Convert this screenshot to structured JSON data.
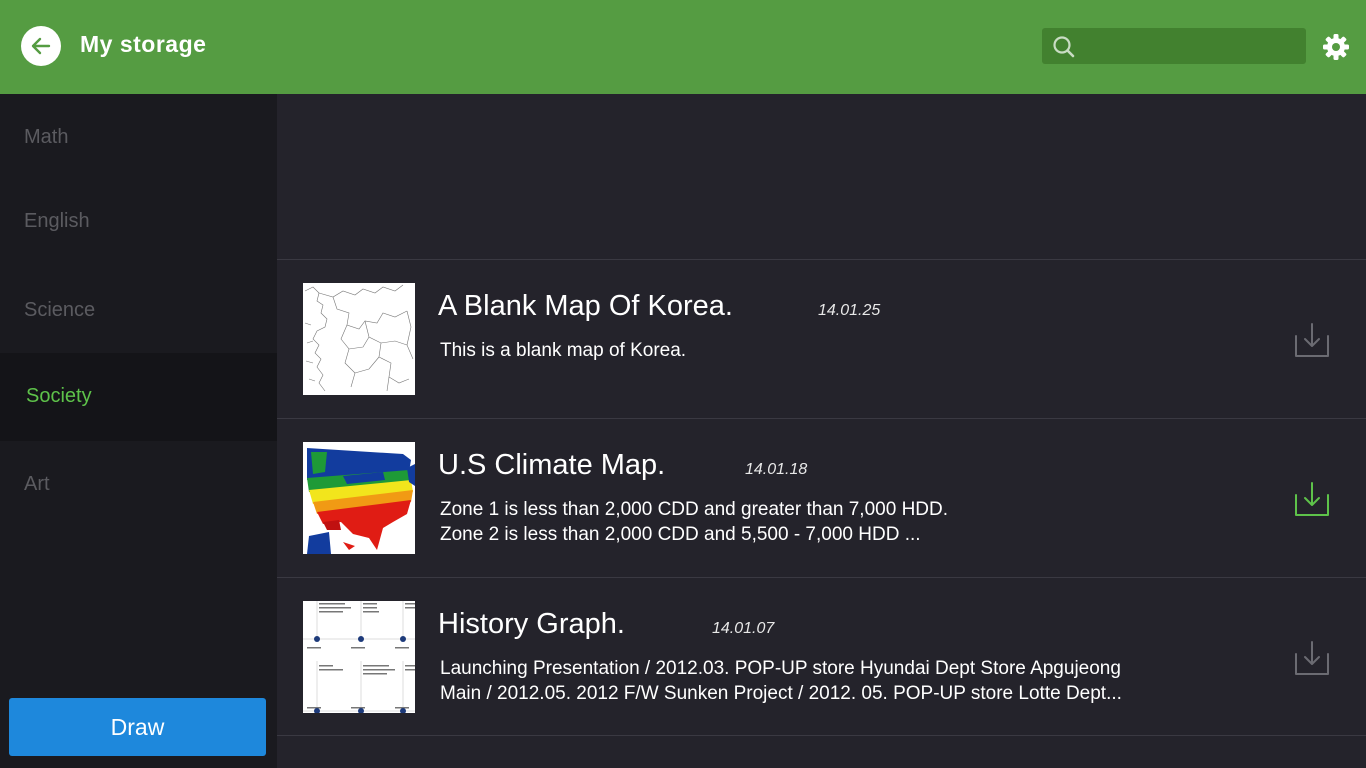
{
  "header": {
    "title": "My storage",
    "search_placeholder": "",
    "icons": {
      "back": "back-arrow-icon",
      "search": "search-icon",
      "settings": "gear-icon"
    }
  },
  "sidebar": {
    "items": [
      {
        "label": "Math",
        "active": false
      },
      {
        "label": "English",
        "active": false
      },
      {
        "label": "Science",
        "active": false
      },
      {
        "label": "Society",
        "active": true
      },
      {
        "label": "Art",
        "active": false
      }
    ],
    "draw_label": "Draw"
  },
  "items": [
    {
      "title": "A Blank Map Of Korea.",
      "date": "14.01.25",
      "desc": [
        "This is a blank map of Korea."
      ],
      "thumbnail": "korea-map-thumbnail",
      "downloaded": false
    },
    {
      "title": "U.S Climate Map.",
      "date": "14.01.18",
      "desc": [
        "Zone 1 is less than 2,000 CDD and greater than 7,000 HDD.",
        "Zone 2 is less than 2,000 CDD and 5,500 - 7,000 HDD ..."
      ],
      "thumbnail": "us-climate-map-thumbnail",
      "downloaded": true
    },
    {
      "title": "History Graph.",
      "date": "14.01.07",
      "desc": [
        "Launching Presentation / 2012.03. POP-UP store Hyundai Dept Store Apgujeong",
        "Main / 2012.05. 2012 F/W Sunken Project / 2012. 05. POP-UP store Lotte Dept..."
      ],
      "thumbnail": "history-timeline-thumbnail",
      "downloaded": false
    }
  ],
  "colors": {
    "header": "#559c42",
    "accent": "#5ec24a",
    "draw_button": "#1e88dc",
    "background": "#24232b",
    "sidebar": "#1a1a1f"
  }
}
